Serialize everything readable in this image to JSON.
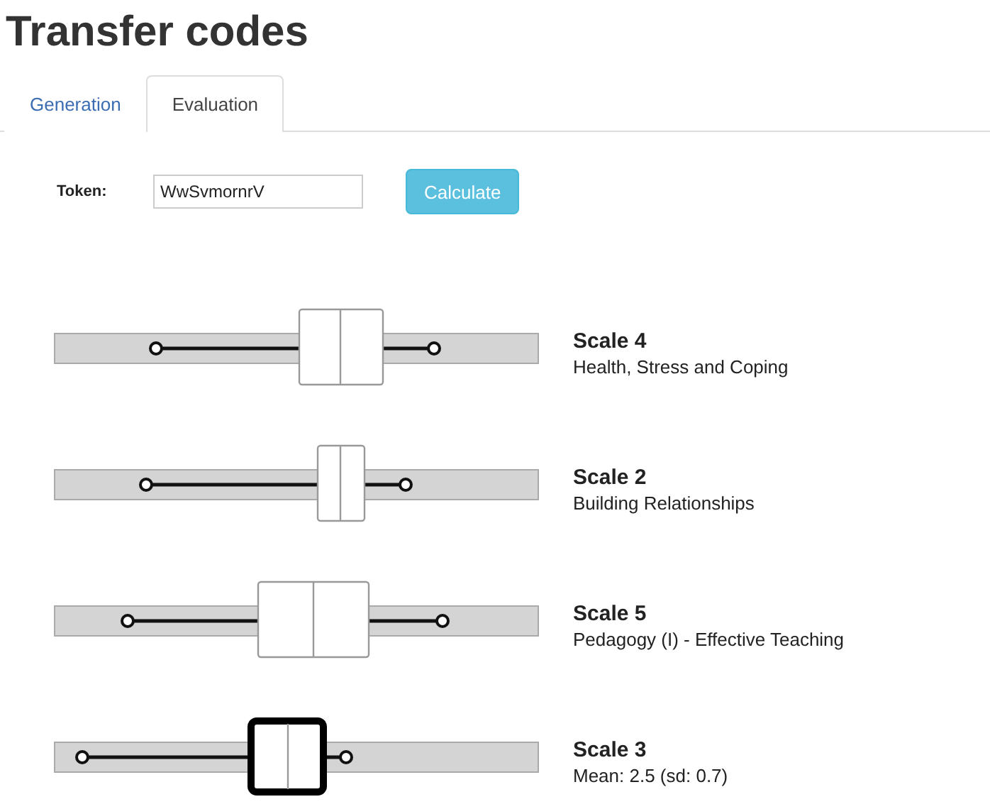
{
  "title": "Transfer codes",
  "tabs": [
    {
      "label": "Generation",
      "selected": false
    },
    {
      "label": "Evaluation",
      "selected": true
    }
  ],
  "token": {
    "label": "Token:",
    "value": "WwSvmornrV"
  },
  "button": "Calculate",
  "scales": [
    {
      "name": "Scale 4",
      "description": "Health, Stress and Coping",
      "selected": false
    },
    {
      "name": "Scale 2",
      "description": "Building Relationships",
      "selected": false
    },
    {
      "name": "Scale 5",
      "description": "Pedagogy (I) - Effective Teaching",
      "selected": false
    },
    {
      "name": "Scale 3",
      "description": "Mean: 2.5 (sd: 0.7)",
      "selected": true
    }
  ]
}
